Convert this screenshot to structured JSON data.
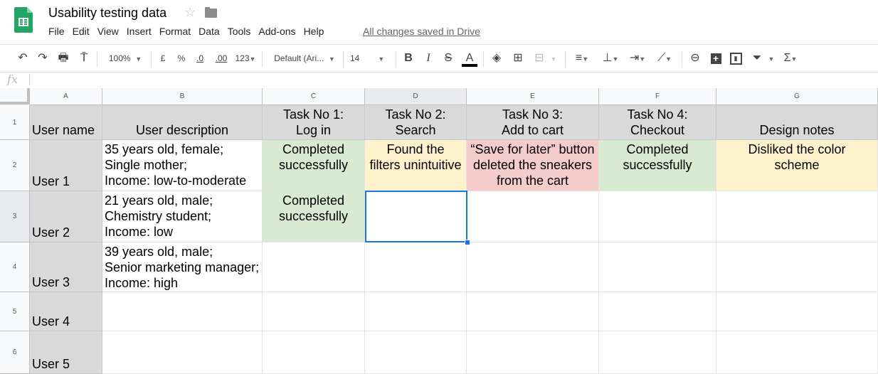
{
  "app": {
    "doc_title": "Usability testing data",
    "save_status": "All changes saved in Drive",
    "menu": [
      "File",
      "Edit",
      "View",
      "Insert",
      "Format",
      "Data",
      "Tools",
      "Add-ons",
      "Help"
    ]
  },
  "toolbar": {
    "zoom": "100%",
    "currency": "£",
    "percent": "%",
    "dec_decrease": ".0",
    "dec_increase": ".00",
    "more_formats": "123",
    "font": "Default (Ari...",
    "font_size": "14",
    "bold": "B",
    "italic": "I",
    "strike": "S",
    "text_color": "A",
    "text_color_value": "#000000"
  },
  "formula_bar": {
    "fx": "fx",
    "value": ""
  },
  "colors": {
    "header_gray": "#d9d9d9",
    "green": "#d9ead3",
    "yellow": "#fff2cc",
    "red": "#f4cccc",
    "selection": "#1a73e8"
  },
  "sheet": {
    "columns": [
      "A",
      "B",
      "C",
      "D",
      "E",
      "F",
      "G"
    ],
    "rows": [
      "1",
      "2",
      "3",
      "4",
      "5",
      "6"
    ],
    "selected_cell": "D3",
    "header": [
      "User name",
      "User description",
      "Task No 1:\nLog in",
      "Task No 2:\nSearch",
      "Task No 3:\nAdd to cart",
      "Task No 4:\nCheckout",
      "Design notes"
    ],
    "data": [
      [
        "User 1",
        "35 years old, female;\nSingle mother;\nIncome: low-to-moderate",
        "Completed\nsuccessfully",
        "Found the\nfilters unintuitive",
        "“Save for later” button\ndeleted the sneakers\nfrom the cart",
        "Completed\nsuccessfully",
        "Disliked the color\nscheme"
      ],
      [
        "User 2",
        "21 years old, male;\nChemistry student;\nIncome: low",
        "Completed\nsuccessfully",
        "",
        "",
        "",
        ""
      ],
      [
        "User 3",
        "39 years old, male;\nSenior marketing manager;\nIncome: high",
        "",
        "",
        "",
        "",
        ""
      ],
      [
        "User 4",
        "",
        "",
        "",
        "",
        "",
        ""
      ],
      [
        "User 5",
        "",
        "",
        "",
        "",
        "",
        ""
      ]
    ]
  }
}
